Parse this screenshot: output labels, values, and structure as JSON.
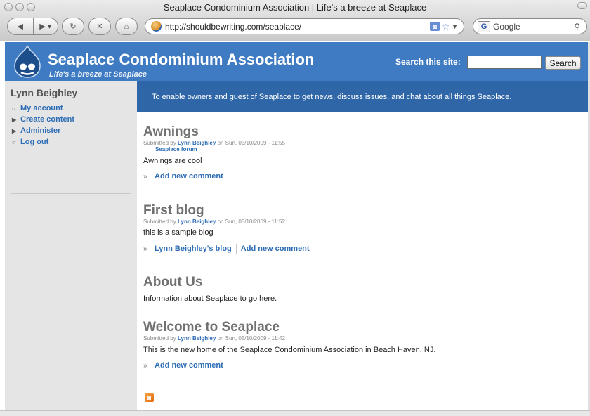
{
  "window": {
    "title": "Seaplace Condominium Association | Life's a breeze at Seaplace"
  },
  "toolbar": {
    "back_icon": "back-arrow-icon",
    "forward_icon": "forward-arrow-icon",
    "url": "http://shouldbewriting.com/seaplace/",
    "search_engine": "Google"
  },
  "site": {
    "name": "Seaplace Condominium Association",
    "slogan": "Life's a breeze at Seaplace",
    "search_label": "Search this site:",
    "search_button": "Search",
    "search_value": "",
    "mission": "To enable owners and guest of Seaplace to get news, discuss issues, and chat about all things Seaplace."
  },
  "sidebar": {
    "title": "Lynn Beighley",
    "items": [
      {
        "label": "My account",
        "bullet": "○"
      },
      {
        "label": "Create content",
        "bullet": "▶"
      },
      {
        "label": "Administer",
        "bullet": "▶"
      },
      {
        "label": "Log out",
        "bullet": "○"
      }
    ]
  },
  "nodes": [
    {
      "title": "Awnings",
      "submitted_prefix": "Submitted by",
      "author": "Lynn Beighley",
      "date": "on Sun, 05/10/2009 - 11:55",
      "taxonomy": "Seaplace forum",
      "body": "Awnings are cool",
      "links": [
        "Add new comment"
      ]
    },
    {
      "title": "First blog",
      "submitted_prefix": "Submitted by",
      "author": "Lynn Beighley",
      "date": "on Sun, 05/10/2009 - 11:52",
      "body": "this is a sample blog",
      "links": [
        "Lynn Beighley's blog",
        "Add new comment"
      ]
    },
    {
      "title": "About Us",
      "body": "Information about Seaplace to go here."
    },
    {
      "title": "Welcome to Seaplace",
      "submitted_prefix": "Submitted by",
      "author": "Lynn Beighley",
      "date": "on Sun, 05/10/2009 - 11:42",
      "body": "This is the new home of the Seaplace Condominium Association in Beach Haven, NJ.",
      "links": [
        "Add new comment"
      ]
    }
  ],
  "colors": {
    "header_blue": "#3f7bc3",
    "mission_blue": "#2f66a8",
    "link_blue": "#2c6cb5",
    "sidebar_gray": "#e5e5e5"
  }
}
